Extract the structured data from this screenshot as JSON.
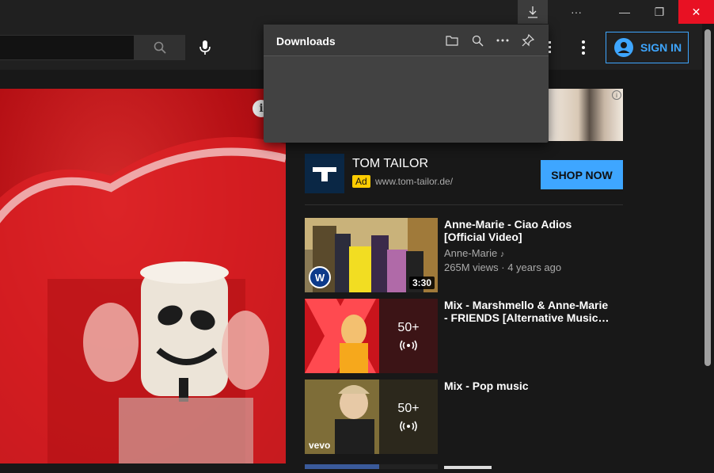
{
  "titlebar": {
    "download_icon": "download-icon",
    "more_label": "···",
    "minimize_label": "—",
    "maximize_label": "❐",
    "close_label": "✕"
  },
  "header": {
    "search_placeholder": "",
    "signin_label": "SIGN IN"
  },
  "downloads": {
    "title": "Downloads"
  },
  "ad": {
    "brand": "TOM TAILOR",
    "badge": "Ad",
    "url": "www.tom-tailor.de/",
    "cta": "SHOP NOW"
  },
  "recommendations": [
    {
      "title_line1": "Anne-Marie - Ciao Adios",
      "title_line2": "[Official Video]",
      "channel": "Anne-Marie",
      "meta": "265M views · 4 years ago",
      "duration": "3:30"
    },
    {
      "title_line1": "Mix - Marshmello & Anne-Marie",
      "title_line2": "- FRIENDS [Alternative Music…",
      "count": "50+"
    },
    {
      "title_line1": "Mix - Pop music",
      "count": "50+",
      "badge": "vevo"
    }
  ],
  "colors": {
    "accent": "#3ea6ff",
    "close": "#e81123",
    "ad_badge": "#ffcc00"
  }
}
